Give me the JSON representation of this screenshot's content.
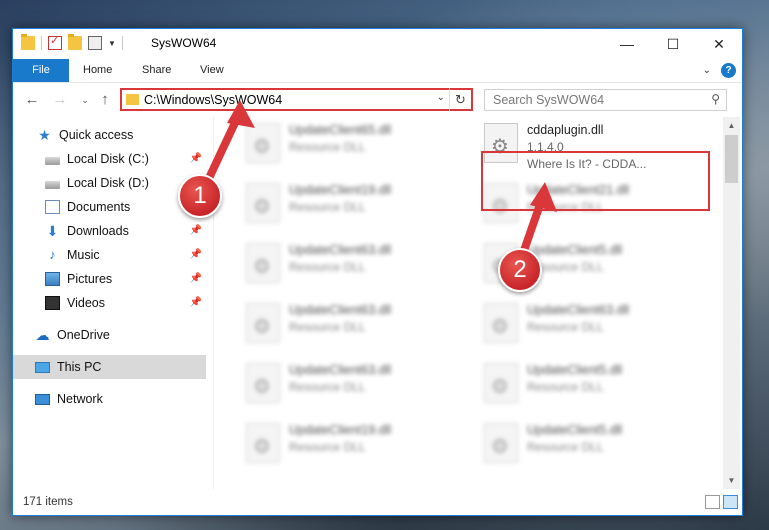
{
  "window": {
    "title": "SysWOW64",
    "controls": {
      "minimize": "—",
      "maximize": "☐",
      "close": "✕"
    }
  },
  "ribbon": {
    "tabs": [
      "File",
      "Home",
      "Share",
      "View"
    ],
    "help": "?"
  },
  "address": {
    "path": "C:\\Windows\\SysWOW64",
    "search_placeholder": "Search SysWOW64"
  },
  "nav": {
    "quick_access": "Quick access",
    "items": [
      {
        "label": "Local Disk (C:)",
        "icon": "disk-icon",
        "pinned": true
      },
      {
        "label": "Local Disk (D:)",
        "icon": "disk-icon",
        "pinned": false
      },
      {
        "label": "Documents",
        "icon": "documents-icon",
        "pinned": true
      },
      {
        "label": "Downloads",
        "icon": "download-icon",
        "pinned": true
      },
      {
        "label": "Music",
        "icon": "music-icon",
        "pinned": true
      },
      {
        "label": "Pictures",
        "icon": "pictures-icon",
        "pinned": true
      },
      {
        "label": "Videos",
        "icon": "videos-icon",
        "pinned": true
      }
    ],
    "onedrive": "OneDrive",
    "this_pc": "This PC",
    "network": "Network"
  },
  "files": {
    "left_column": [
      {
        "name": "UpdateClient65.dll",
        "type": "Resource DLL"
      },
      {
        "name": "UpdateClient19.dll",
        "type": "Resource DLL"
      },
      {
        "name": "UpdateClient63.dll",
        "type": "Resource DLL"
      },
      {
        "name": "UpdateClient63.dll",
        "type": "Resource DLL"
      },
      {
        "name": "UpdateClient63.dll",
        "type": "Resource DLL"
      },
      {
        "name": "UpdateClient19.dll",
        "type": "Resource DLL"
      }
    ],
    "right_column": [
      {
        "name": "cddaplugin.dll",
        "version": "1.1.4.0",
        "description": "Where Is It? - CDDA..."
      },
      {
        "name": "UpdateClient21.dll",
        "type": "Resource DLL"
      },
      {
        "name": "UpdateClient5.dll",
        "type": "Resource DLL"
      },
      {
        "name": "UpdateClient63.dll",
        "type": "Resource DLL"
      },
      {
        "name": "UpdateClient5.dll",
        "type": "Resource DLL"
      },
      {
        "name": "UpdateClient5.dll",
        "type": "Resource DLL"
      }
    ]
  },
  "status": {
    "item_count": "171 items"
  },
  "callouts": {
    "one": "1",
    "two": "2"
  },
  "colors": {
    "accent": "#1979ca",
    "highlight": "#d9373a"
  }
}
